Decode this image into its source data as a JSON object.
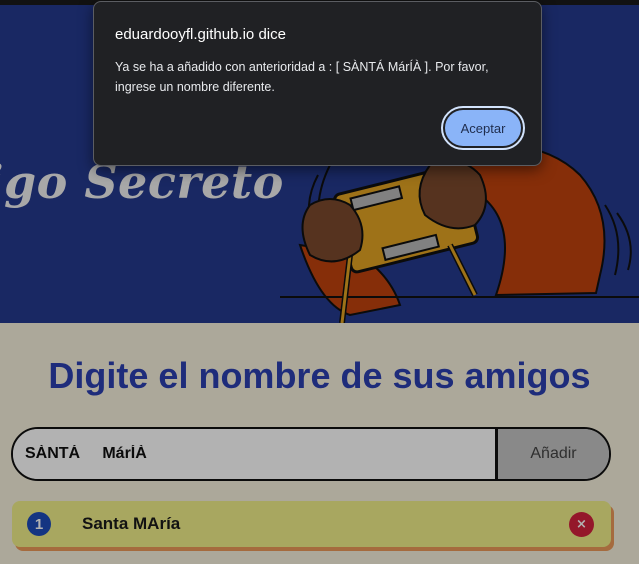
{
  "hero": {
    "title": "igo Secreto"
  },
  "main": {
    "heading": "Digite el nombre de sus amigos",
    "name_input_value": "SÀNTÁ     MárÍÀ",
    "add_button_label": "Añadir",
    "friends": [
      {
        "number": "1",
        "name": "Santa MAría",
        "remove_icon": "×"
      }
    ]
  },
  "dialog": {
    "title": "eduardooyfl.github.io dice",
    "message": "Ya se ha a añadido con anterioridad a : [ SÀNTÁ MárÍÀ ]. Por favor, ingrese un nombre diferente.",
    "accept_label": "Aceptar"
  },
  "colors": {
    "hero_background": "#243a8f",
    "heading_blue": "#2b3fb0",
    "main_background": "#f7f1dd",
    "friend_item": "#f1f08a",
    "remove_button": "#d4213d",
    "dialog_background": "#202124",
    "accept_button": "#8ab4f8"
  }
}
